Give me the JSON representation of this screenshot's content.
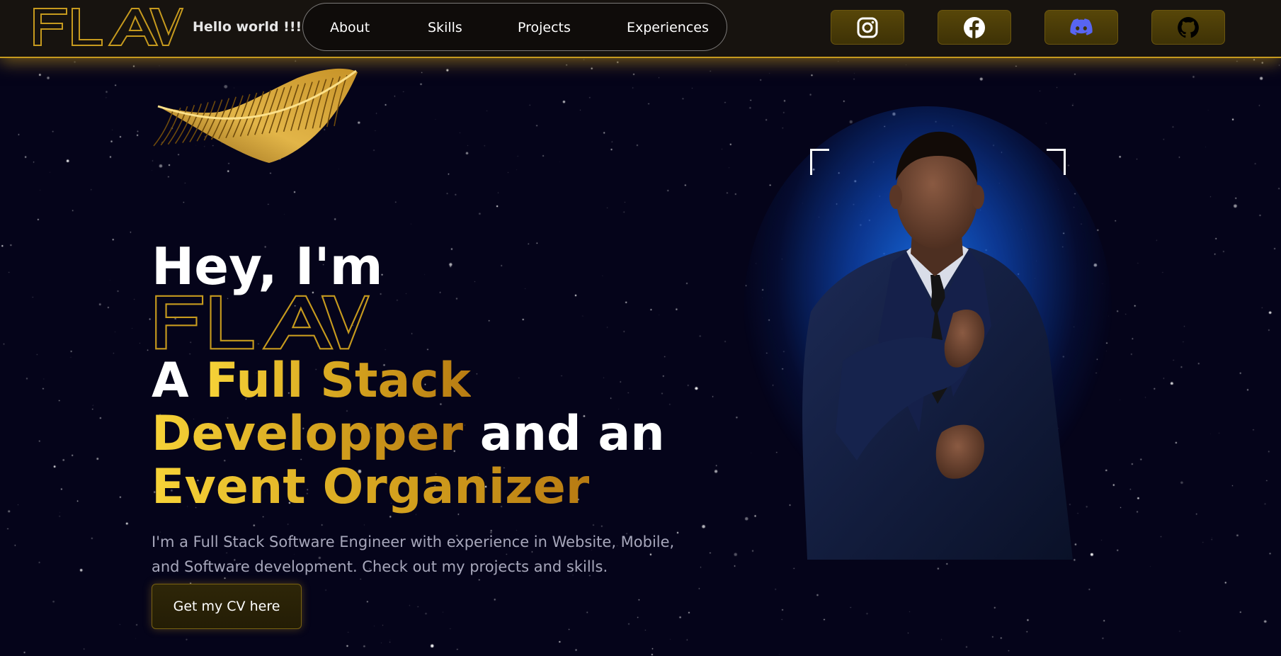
{
  "header": {
    "logo_text": "FLAV",
    "tagline": "Hello world !!!",
    "nav": [
      "About",
      "Skills",
      "Projects",
      "Experiences"
    ],
    "social": [
      "instagram-icon",
      "facebook-icon",
      "discord-icon",
      "github-icon"
    ]
  },
  "hero": {
    "greeting": "Hey, I'm",
    "name_logo": "FLAV",
    "headline": {
      "a": "A ",
      "full_stack": "Full Stack",
      "developer": "Developper",
      "and_an": " and an",
      "event_organizer": "Event Organizer"
    },
    "intro": "I'm a Full Stack Software Engineer with experience in Website, Mobile, and Software development. Check out my projects and skills.",
    "cta_label": "Get my CV here"
  },
  "colors": {
    "accent_gold": "#c69a1e",
    "gold_light": "#f7d338",
    "header_bg": "#17130f",
    "page_bg": "#05041a",
    "glow_blue": "#186ee6",
    "discord": "#5865f2"
  }
}
